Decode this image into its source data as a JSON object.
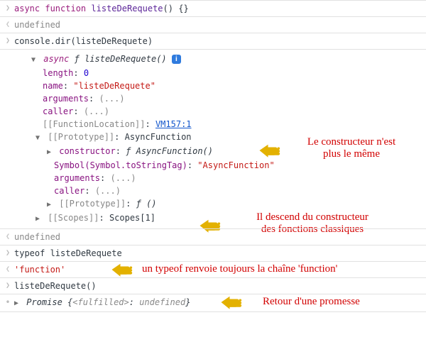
{
  "rows": {
    "r1": {
      "kw_async": "async",
      "kw_func": "function",
      "name": "listeDeRequete",
      "suffix": "() {}"
    },
    "r2_undef": "undefined",
    "r3": {
      "call": "console.dir(listeDeRequete)"
    },
    "r5_undef": "undefined",
    "r6": "typeof listeDeRequete",
    "r7": "'function'",
    "r8": "listeDeRequete()",
    "r9": {
      "promise": "Promise",
      "open": " {",
      "state_key": "<fulfilled>",
      "colon": ": ",
      "state_val": "undefined",
      "close": "}"
    }
  },
  "obj": {
    "head_async": "async",
    "head_f": "ƒ",
    "head_name": "listeDeRequete()",
    "length_key": "length",
    "length_val": "0",
    "name_key": "name",
    "name_val": "\"listeDeRequete\"",
    "args_key": "arguments",
    "args_val": "(...)",
    "caller_key": "caller",
    "caller_val": "(...)",
    "floc_key": "[[FunctionLocation]]",
    "floc_val": "VM157:1",
    "proto_key": "[[Prototype]]",
    "proto_val": "AsyncFunction",
    "ctor_key": "constructor",
    "ctor_val_f": "ƒ",
    "ctor_val_name": "AsyncFunction()",
    "sym_key": "Symbol(Symbol.toStringTag)",
    "sym_val": "\"AsyncFunction\"",
    "p_args_key": "arguments",
    "p_args_val": "(...)",
    "p_caller_key": "caller",
    "p_caller_val": "(...)",
    "p_proto_key": "[[Prototype]]",
    "p_proto_val_f": "ƒ",
    "p_proto_val_paren": "()",
    "scopes_key": "[[Scopes]]",
    "scopes_val": "Scopes[1]"
  },
  "ann": {
    "a1_l1": "Le constructeur n'est",
    "a1_l2": "plus le même",
    "a2_l1": "Il descend du constructeur",
    "a2_l2": "des fonctions classiques",
    "a3": "un typeof renvoie toujours la chaîne 'function'",
    "a4": "Retour d'une promesse"
  },
  "icons": {
    "triangle_right": "▶",
    "triangle_down": "▼",
    "info": "i"
  }
}
